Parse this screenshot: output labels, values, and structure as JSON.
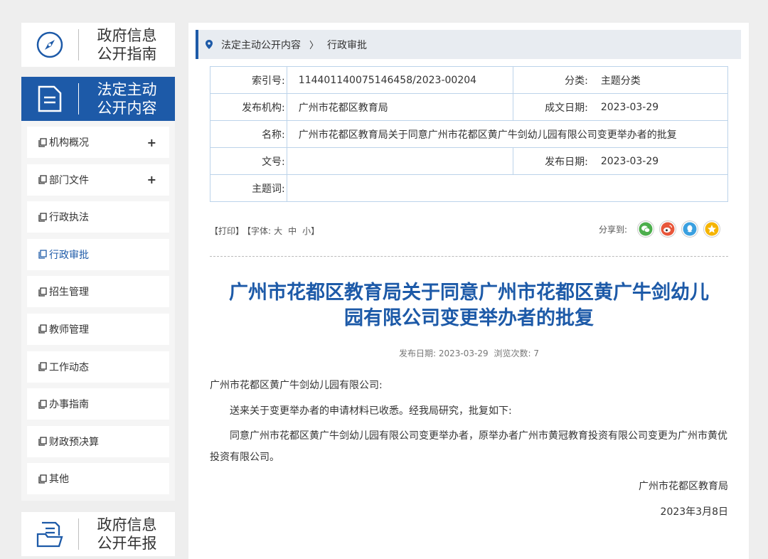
{
  "sidebar": {
    "guide": {
      "line1": "政府信息",
      "line2": "公开指南"
    },
    "active": {
      "line1": "法定主动",
      "line2": "公开内容"
    },
    "items": [
      {
        "label": "机构概况",
        "plus": "+"
      },
      {
        "label": "部门文件",
        "plus": "+"
      },
      {
        "label": "行政执法"
      },
      {
        "label": "行政审批",
        "active": true
      },
      {
        "label": "招生管理"
      },
      {
        "label": "教师管理"
      },
      {
        "label": "工作动态"
      },
      {
        "label": "办事指南"
      },
      {
        "label": "财政预决算"
      },
      {
        "label": "其他"
      }
    ],
    "report": {
      "line1": "政府信息",
      "line2": "公开年报"
    }
  },
  "breadcrumb": {
    "level1": "法定主动公开内容",
    "arrow": "〉",
    "level2": "行政审批"
  },
  "meta": {
    "index_label": "索引号:",
    "index_value": "114401140075146458/2023-00204",
    "category_label": "分类:",
    "category_value": "主题分类",
    "publisher_label": "发布机构:",
    "publisher_value": "广州市花都区教育局",
    "written_label": "成文日期:",
    "written_value": "2023-03-29",
    "name_label": "名称:",
    "name_value": "广州市花都区教育局关于同意广州市花都区黄广牛剑幼儿园有限公司变更举办者的批复",
    "docno_label": "文号:",
    "docno_value": "",
    "pubdate_label": "发布日期:",
    "pubdate_value": "2023-03-29",
    "keywords_label": "主题词:",
    "keywords_value": ""
  },
  "tools": {
    "print": "【打印】",
    "font": "【字体:",
    "large": "大",
    "medium": "中",
    "small": "小】"
  },
  "share": {
    "label": "分享到:"
  },
  "article": {
    "title_line1": "广州市花都区教育局关于同意广州市花都区黄广牛剑幼儿",
    "title_line2": "园有限公司变更举办者的批复",
    "date_label": "发布日期:",
    "date_value": "2023-03-29",
    "views_label": "浏览次数:",
    "views_value": "7",
    "salutation": "广州市花都区黄广牛剑幼儿园有限公司:",
    "para1": "送来关于变更举办者的申请材料已收悉。经我局研究，批复如下:",
    "para2": "同意广州市花都区黄广牛剑幼儿园有限公司变更举办者，原举办者广州市黄冠教育投资有限公司变更为广州市黄优投资有限公司。",
    "signature": "广州市花都区教育局",
    "sign_date": "2023年3月8日"
  },
  "colors": {
    "accent": "#1d5aa8",
    "background": "#eeeeee"
  }
}
